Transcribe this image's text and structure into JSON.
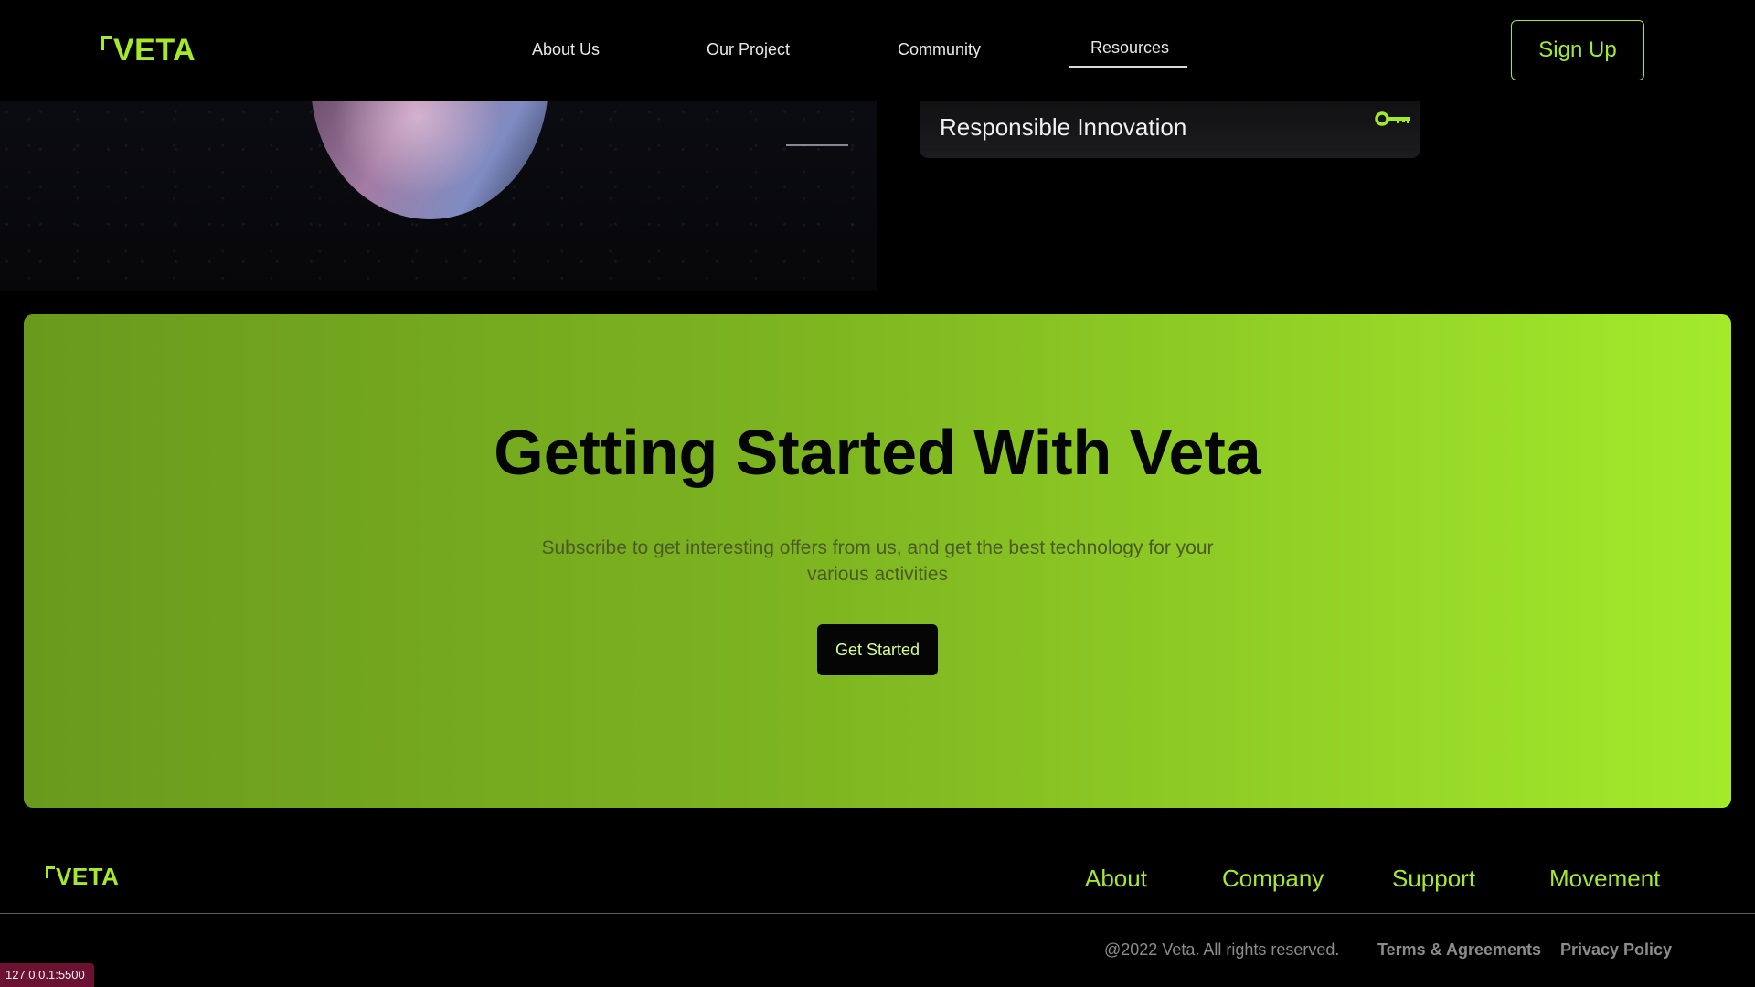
{
  "brand": {
    "name": "VETA",
    "accent": "#a4ea2b"
  },
  "nav": {
    "items": [
      {
        "label": "About Us"
      },
      {
        "label": "Our Project"
      },
      {
        "label": "Community"
      },
      {
        "label": "Resources",
        "active": true
      }
    ],
    "signup_label": "Sign Up"
  },
  "feature_card": {
    "title": "Responsible Innovation",
    "icon": "key-icon"
  },
  "cta": {
    "title": "Getting Started With Veta",
    "subtitle": "Subscribe to get interesting offers from us, and get the best technology for your various activities",
    "button_label": "Get Started"
  },
  "footer": {
    "links": [
      "About",
      "Company",
      "Support",
      "Movement"
    ],
    "copyright": "@2022 Veta. All rights reserved.",
    "legal": [
      "Terms & Agreements",
      "Privacy Policy"
    ]
  },
  "status_bar": {
    "url": "127.0.0.1:5500"
  }
}
